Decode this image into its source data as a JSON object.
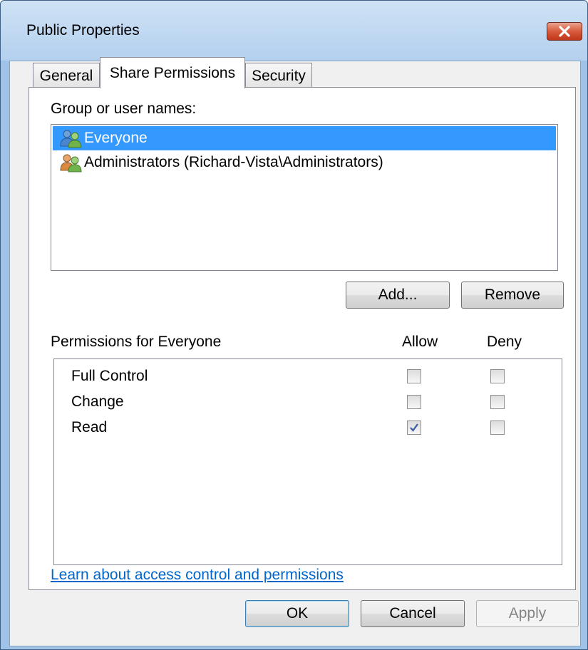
{
  "window": {
    "title": "Public Properties"
  },
  "tabs": [
    {
      "label": "General",
      "active": false
    },
    {
      "label": "Share Permissions",
      "active": true
    },
    {
      "label": "Security",
      "active": false
    }
  ],
  "group_section": {
    "label": "Group or user names:",
    "items": [
      {
        "name": "Everyone",
        "selected": true,
        "icon": "users-icon"
      },
      {
        "name": "Administrators (Richard-Vista\\Administrators)",
        "selected": false,
        "icon": "users-icon"
      }
    ]
  },
  "buttons": {
    "add": "Add...",
    "remove": "Remove",
    "ok": "OK",
    "cancel": "Cancel",
    "apply": "Apply"
  },
  "permissions": {
    "label": "Permissions for Everyone",
    "allow_header": "Allow",
    "deny_header": "Deny",
    "rows": [
      {
        "name": "Full Control",
        "allow": false,
        "deny": false
      },
      {
        "name": "Change",
        "allow": false,
        "deny": false
      },
      {
        "name": "Read",
        "allow": true,
        "deny": false
      }
    ]
  },
  "help_link": "Learn about access control and permissions",
  "colors": {
    "selection": "#3399ff",
    "link": "#0066cc",
    "close_button": "#c1361a",
    "check": "#3b5aa6"
  }
}
